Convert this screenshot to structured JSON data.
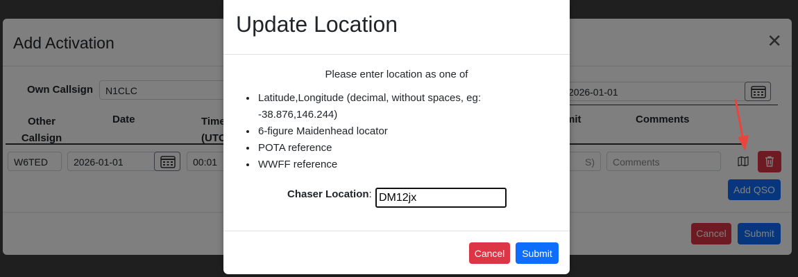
{
  "background_modal": {
    "title": "Add Activation",
    "close_glyph": "✕",
    "own_callsign_label": "Own Callsign",
    "own_callsign_value": "N1CLC",
    "date_value": "2026-01-01",
    "columns": {
      "other_callsign": "Other\nCallsign",
      "date": "Date",
      "time": "Time\n(UTC",
      "summit": "mit",
      "comments": "Comments"
    },
    "row": {
      "callsign": "W6TED",
      "date": "2026-01-01",
      "time": "00:01",
      "summit_fragment": "S)",
      "comments_placeholder": "Comments"
    },
    "add_qso_label": "Add QSO",
    "cancel_label": "Cancel",
    "submit_label": "Submit"
  },
  "dialog": {
    "title": "Update Location",
    "intro": "Please enter location as one of",
    "options": [
      "Latitude,Longitude (decimal, without spaces, eg: -38.876,146.244)",
      "6-figure Maidenhead locator",
      "POTA reference",
      "WWFF reference"
    ],
    "chaser_label": "Chaser Location",
    "chaser_colon": ":",
    "chaser_value": "DM12jx",
    "cancel_label": "Cancel",
    "submit_label": "Submit"
  },
  "colors": {
    "primary": "#0d6efd",
    "danger": "#dc3545",
    "arrow": "#e8453c"
  },
  "icons": [
    "close-icon",
    "calendar-icon",
    "map-icon",
    "trash-icon"
  ]
}
